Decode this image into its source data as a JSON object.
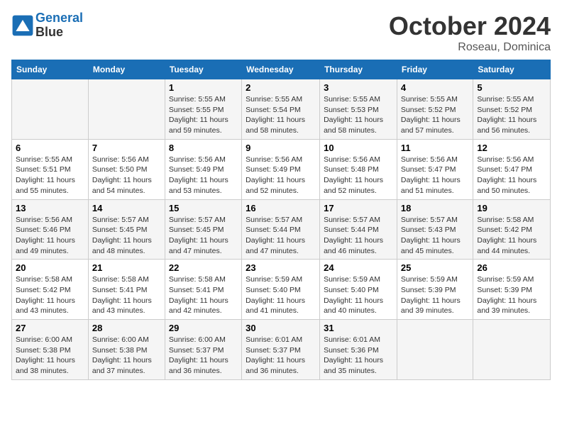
{
  "logo": {
    "line1": "General",
    "line2": "Blue"
  },
  "title": "October 2024",
  "subtitle": "Roseau, Dominica",
  "days_of_week": [
    "Sunday",
    "Monday",
    "Tuesday",
    "Wednesday",
    "Thursday",
    "Friday",
    "Saturday"
  ],
  "weeks": [
    [
      {
        "day": "",
        "info": ""
      },
      {
        "day": "",
        "info": ""
      },
      {
        "day": "1",
        "info": "Sunrise: 5:55 AM\nSunset: 5:55 PM\nDaylight: 11 hours and 59 minutes."
      },
      {
        "day": "2",
        "info": "Sunrise: 5:55 AM\nSunset: 5:54 PM\nDaylight: 11 hours and 58 minutes."
      },
      {
        "day": "3",
        "info": "Sunrise: 5:55 AM\nSunset: 5:53 PM\nDaylight: 11 hours and 58 minutes."
      },
      {
        "day": "4",
        "info": "Sunrise: 5:55 AM\nSunset: 5:52 PM\nDaylight: 11 hours and 57 minutes."
      },
      {
        "day": "5",
        "info": "Sunrise: 5:55 AM\nSunset: 5:52 PM\nDaylight: 11 hours and 56 minutes."
      }
    ],
    [
      {
        "day": "6",
        "info": "Sunrise: 5:55 AM\nSunset: 5:51 PM\nDaylight: 11 hours and 55 minutes."
      },
      {
        "day": "7",
        "info": "Sunrise: 5:56 AM\nSunset: 5:50 PM\nDaylight: 11 hours and 54 minutes."
      },
      {
        "day": "8",
        "info": "Sunrise: 5:56 AM\nSunset: 5:49 PM\nDaylight: 11 hours and 53 minutes."
      },
      {
        "day": "9",
        "info": "Sunrise: 5:56 AM\nSunset: 5:49 PM\nDaylight: 11 hours and 52 minutes."
      },
      {
        "day": "10",
        "info": "Sunrise: 5:56 AM\nSunset: 5:48 PM\nDaylight: 11 hours and 52 minutes."
      },
      {
        "day": "11",
        "info": "Sunrise: 5:56 AM\nSunset: 5:47 PM\nDaylight: 11 hours and 51 minutes."
      },
      {
        "day": "12",
        "info": "Sunrise: 5:56 AM\nSunset: 5:47 PM\nDaylight: 11 hours and 50 minutes."
      }
    ],
    [
      {
        "day": "13",
        "info": "Sunrise: 5:56 AM\nSunset: 5:46 PM\nDaylight: 11 hours and 49 minutes."
      },
      {
        "day": "14",
        "info": "Sunrise: 5:57 AM\nSunset: 5:45 PM\nDaylight: 11 hours and 48 minutes."
      },
      {
        "day": "15",
        "info": "Sunrise: 5:57 AM\nSunset: 5:45 PM\nDaylight: 11 hours and 47 minutes."
      },
      {
        "day": "16",
        "info": "Sunrise: 5:57 AM\nSunset: 5:44 PM\nDaylight: 11 hours and 47 minutes."
      },
      {
        "day": "17",
        "info": "Sunrise: 5:57 AM\nSunset: 5:44 PM\nDaylight: 11 hours and 46 minutes."
      },
      {
        "day": "18",
        "info": "Sunrise: 5:57 AM\nSunset: 5:43 PM\nDaylight: 11 hours and 45 minutes."
      },
      {
        "day": "19",
        "info": "Sunrise: 5:58 AM\nSunset: 5:42 PM\nDaylight: 11 hours and 44 minutes."
      }
    ],
    [
      {
        "day": "20",
        "info": "Sunrise: 5:58 AM\nSunset: 5:42 PM\nDaylight: 11 hours and 43 minutes."
      },
      {
        "day": "21",
        "info": "Sunrise: 5:58 AM\nSunset: 5:41 PM\nDaylight: 11 hours and 43 minutes."
      },
      {
        "day": "22",
        "info": "Sunrise: 5:58 AM\nSunset: 5:41 PM\nDaylight: 11 hours and 42 minutes."
      },
      {
        "day": "23",
        "info": "Sunrise: 5:59 AM\nSunset: 5:40 PM\nDaylight: 11 hours and 41 minutes."
      },
      {
        "day": "24",
        "info": "Sunrise: 5:59 AM\nSunset: 5:40 PM\nDaylight: 11 hours and 40 minutes."
      },
      {
        "day": "25",
        "info": "Sunrise: 5:59 AM\nSunset: 5:39 PM\nDaylight: 11 hours and 39 minutes."
      },
      {
        "day": "26",
        "info": "Sunrise: 5:59 AM\nSunset: 5:39 PM\nDaylight: 11 hours and 39 minutes."
      }
    ],
    [
      {
        "day": "27",
        "info": "Sunrise: 6:00 AM\nSunset: 5:38 PM\nDaylight: 11 hours and 38 minutes."
      },
      {
        "day": "28",
        "info": "Sunrise: 6:00 AM\nSunset: 5:38 PM\nDaylight: 11 hours and 37 minutes."
      },
      {
        "day": "29",
        "info": "Sunrise: 6:00 AM\nSunset: 5:37 PM\nDaylight: 11 hours and 36 minutes."
      },
      {
        "day": "30",
        "info": "Sunrise: 6:01 AM\nSunset: 5:37 PM\nDaylight: 11 hours and 36 minutes."
      },
      {
        "day": "31",
        "info": "Sunrise: 6:01 AM\nSunset: 5:36 PM\nDaylight: 11 hours and 35 minutes."
      },
      {
        "day": "",
        "info": ""
      },
      {
        "day": "",
        "info": ""
      }
    ]
  ]
}
